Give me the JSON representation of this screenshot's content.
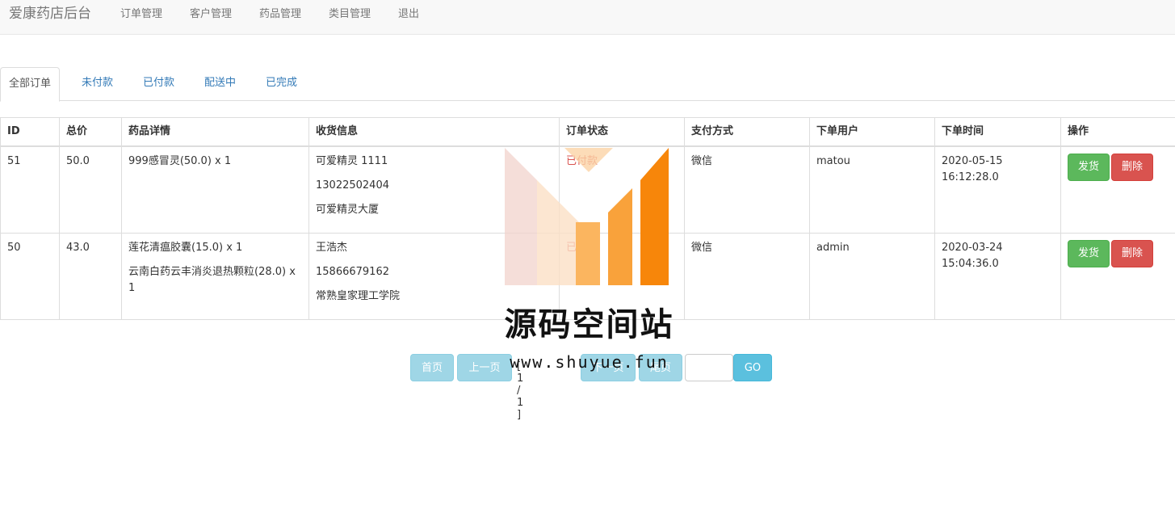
{
  "navbar": {
    "brand": "爱康药店后台",
    "links": [
      "订单管理",
      "客户管理",
      "药品管理",
      "类目管理",
      "退出"
    ]
  },
  "tabs": [
    "全部订单",
    "未付款",
    "已付款",
    "配送中",
    "已完成"
  ],
  "table": {
    "headers": [
      "ID",
      "总价",
      "药品详情",
      "收货信息",
      "订单状态",
      "支付方式",
      "下单用户",
      "下单时间",
      "操作"
    ],
    "rows": [
      {
        "id": "51",
        "total": "50.0",
        "items": [
          "999感冒灵(50.0) x 1"
        ],
        "receiver": [
          "可爱精灵 1111",
          "13022502404",
          "可爱精灵大厦"
        ],
        "status": "已付款",
        "payment": "微信",
        "user": "matou",
        "time": "2020-05-15 16:12:28.0"
      },
      {
        "id": "50",
        "total": "43.0",
        "items": [
          "莲花清瘟胶囊(15.0) x 1",
          "云南白药云丰消炎退热颗粒(28.0) x 1"
        ],
        "receiver": [
          "王浩杰",
          "15866679162",
          "常熟皇家理工学院"
        ],
        "status": "已付款",
        "payment": "微信",
        "user": "admin",
        "time": "2020-03-24 15:04:36.0"
      }
    ],
    "ship_label": "发货",
    "delete_label": "删除"
  },
  "pager": {
    "first": "首页",
    "prev": "上一页",
    "info": "[ 1 / 1 ]",
    "next": "下一页",
    "last": "尾页",
    "go": "GO"
  },
  "watermark": {
    "title": "源码空间站",
    "url": "www.shuyue.fun"
  },
  "colors": {
    "success": "#5cb85c",
    "danger": "#d9534f",
    "info": "#5bc0de",
    "link": "#337ab7",
    "watermark_orange": "#f7860a"
  }
}
